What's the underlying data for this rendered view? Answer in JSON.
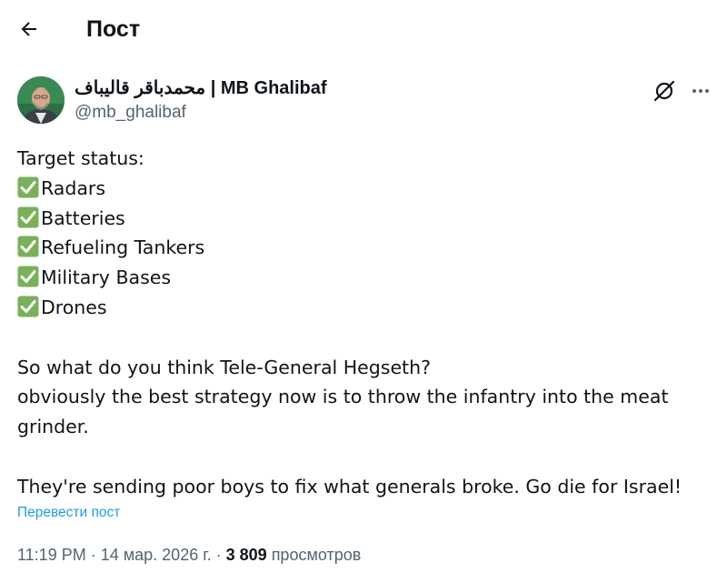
{
  "header": {
    "title": "Пост"
  },
  "author": {
    "name": "محمدباقر قالیباف | MB Ghalibaf",
    "handle": "@mb_ghalibaf"
  },
  "post": {
    "intro": "Target status:",
    "checklist": [
      "Radars",
      "Batteries",
      "Refueling Tankers",
      "Military Bases",
      "Drones"
    ],
    "paragraph_1": "So what do you think Tele-General Hegseth?\nobviously the best strategy now is to throw the infantry into the meat grinder.",
    "paragraph_1_line_1": "So what do you think Tele-General Hegseth?",
    "paragraph_1_line_2": "obviously the best strategy now is to throw the infantry into the meat",
    "paragraph_1_line_3": "grinder.",
    "paragraph_2": "They're sending poor boys to fix what generals broke. Go die for Israel!"
  },
  "translate": {
    "label": "Перевести пост"
  },
  "meta": {
    "time": "11:19 PM",
    "date": "14 мар. 2026 г.",
    "views_count": "3 809",
    "views_label": "просмотров",
    "separator": "·"
  },
  "colors": {
    "text": "#0f1419",
    "secondary": "#536471",
    "link": "#1d9bf0",
    "check": "#78b159"
  }
}
